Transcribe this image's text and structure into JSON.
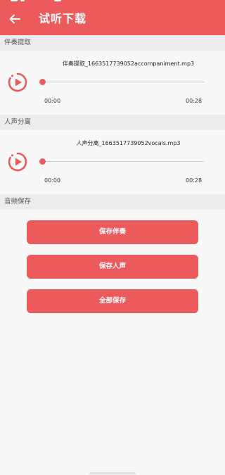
{
  "app": {
    "title": "试听下载",
    "colors": {
      "accent": "#ec5a5c",
      "section_bg": "#ececec",
      "page_bg": "#f8f8f8"
    }
  },
  "sections": {
    "accompaniment": {
      "header": "伴奏提取"
    },
    "vocals": {
      "header": "人声分离"
    },
    "save": {
      "header": "音频保存"
    }
  },
  "players": [
    {
      "filename": "伴奏提取_1663517739052accompaniment.mp3",
      "current_time": "00:00",
      "duration": "00:28",
      "progress": 0,
      "icon": "play-circle-icon"
    },
    {
      "filename": "人声分离_1663517739052vocals.mp3",
      "current_time": "00:00",
      "duration": "00:28",
      "progress": 0,
      "icon": "play-circle-icon"
    }
  ],
  "actions": {
    "save_accompaniment": "保存伴奏",
    "save_vocals": "保存人声",
    "save_all": "全部保存"
  }
}
